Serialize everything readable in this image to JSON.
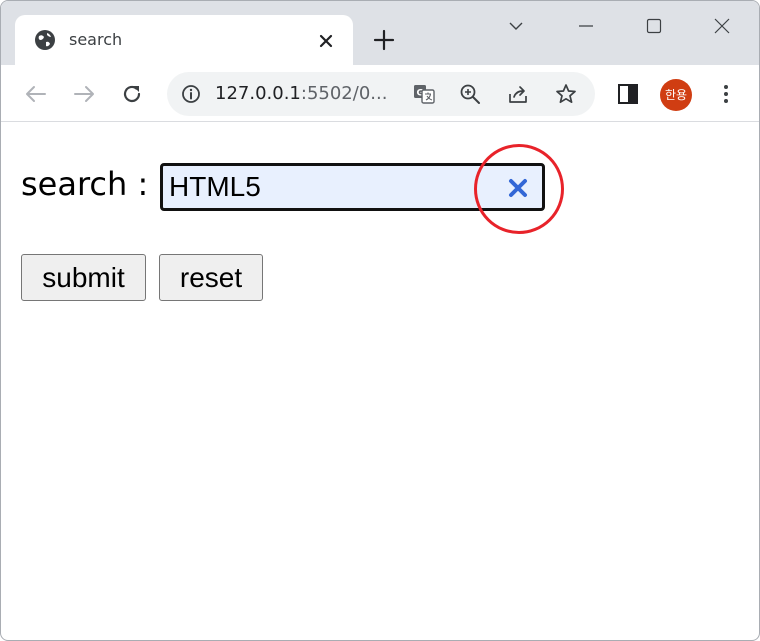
{
  "browser": {
    "tab": {
      "title": "search",
      "favicon": "globe-icon"
    },
    "address_bar": {
      "url_host": "127.0.0.1",
      "url_rest": ":5502/0..."
    },
    "profile": {
      "initials": "한용",
      "color": "#d03d12"
    }
  },
  "page": {
    "search_label": "search :",
    "search_value": "HTML5",
    "clear_icon": "close-x-icon",
    "clear_icon_color": "#3367d6",
    "highlight_color": "#e8232a",
    "buttons": {
      "submit": "submit",
      "reset": "reset"
    }
  }
}
